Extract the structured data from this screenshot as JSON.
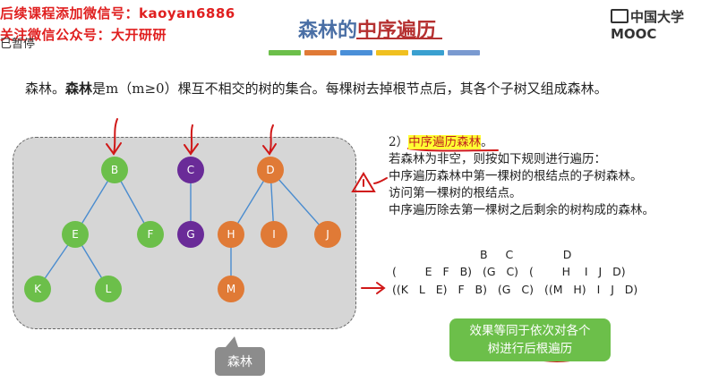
{
  "watermark": {
    "line1": "后续课程添加微信号：kaoyan6886",
    "line2": "关注微信公众号：大开研研",
    "paused": "已暂停"
  },
  "slide": {
    "title_prefix": "森林的",
    "title_highlight": "中序遍历",
    "logo": "中国大学MOOC",
    "definition_lead": "森林。",
    "definition_term": "森林",
    "definition_body": "是m（m≥0）棵互不相交的树的集合。每棵树去掉根节点后，其各个子树又组成森林。"
  },
  "forest": {
    "label": "森林",
    "nodes": [
      {
        "id": "B",
        "color": "green"
      },
      {
        "id": "C",
        "color": "purple"
      },
      {
        "id": "D",
        "color": "orange"
      },
      {
        "id": "E",
        "color": "green"
      },
      {
        "id": "F",
        "color": "green"
      },
      {
        "id": "G",
        "color": "purple"
      },
      {
        "id": "H",
        "color": "orange"
      },
      {
        "id": "I",
        "color": "orange"
      },
      {
        "id": "J",
        "color": "orange"
      },
      {
        "id": "K",
        "color": "green"
      },
      {
        "id": "L",
        "color": "green"
      },
      {
        "id": "M",
        "color": "orange"
      }
    ]
  },
  "rules": {
    "number": "2）",
    "title": "中序遍历森林",
    "title_suffix": "。",
    "line1": "若森林为非空，则按如下规则进行遍历：",
    "line2": "中序遍历森林中第一棵树的根结点的子树森林。",
    "line3": "访问第一棵树的根结点。",
    "line4": "中序遍历除去第一棵树之后剩余的树构成的森林。"
  },
  "sequence": {
    "roots_line": "B     C              D",
    "line1": "(        E   F   B)   (G   C)   (        H    I   J   D)",
    "line2": "((K   L   E)   F   B)   (G   C)   ((M   H)   I   J   D)"
  },
  "callout": {
    "line1": "效果等同于依次对各个",
    "line2": "树进行后根遍历"
  },
  "colors": {
    "green": "#6cbf4a",
    "purple": "#6a2b98",
    "orange": "#e07a36",
    "title_blue": "#4a6fa5",
    "annotation_red": "#d01818"
  }
}
